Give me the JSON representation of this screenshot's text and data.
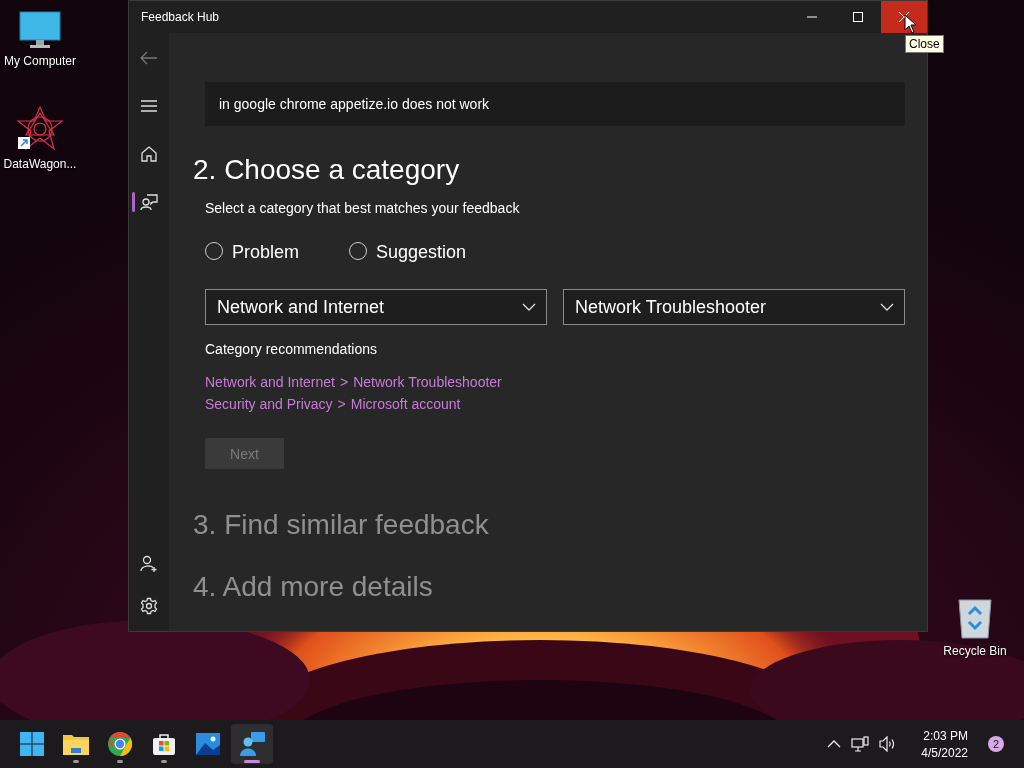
{
  "desktop_icons": [
    {
      "label": "My Computer",
      "kind": "computer"
    },
    {
      "label": "DataWagon...",
      "kind": "shortcut"
    },
    {
      "label": "Recycle Bin",
      "kind": "recycle"
    }
  ],
  "window": {
    "title": "Feedback Hub",
    "tooltip": "Close"
  },
  "nav_items": [
    {
      "kind": "home",
      "selected": false
    },
    {
      "kind": "feedback",
      "selected": true
    }
  ],
  "nav_bottom": [
    {
      "kind": "add-user"
    },
    {
      "kind": "settings"
    }
  ],
  "summary": {
    "value": "in google chrome appetize.io does not work"
  },
  "section": {
    "heading": "2. Choose a category",
    "instruction": "Select a category that best matches your feedback",
    "options": [
      {
        "label": "Problem",
        "selected": false
      },
      {
        "label": "Suggestion",
        "selected": false
      }
    ],
    "dropdowns": [
      {
        "value": "Network and Internet"
      },
      {
        "value": "Network Troubleshooter"
      }
    ],
    "recommendations_label": "Category recommendations",
    "recommendations": [
      {
        "category": "Network and Internet",
        "separator": ">",
        "subcategory": "Network Troubleshooter"
      },
      {
        "category": "Security and Privacy",
        "separator": ">",
        "subcategory": "Microsoft account"
      }
    ],
    "next": {
      "label": "Next",
      "disabled": true
    }
  },
  "later_steps": [
    "3. Find similar feedback",
    "4. Add more details"
  ],
  "taskbar": {
    "apps": [
      {
        "kind": "start",
        "running": false,
        "selected": false
      },
      {
        "kind": "folder",
        "running": true,
        "selected": false
      },
      {
        "kind": "browser",
        "running": true,
        "selected": false
      },
      {
        "kind": "store",
        "running": true,
        "selected": false
      },
      {
        "kind": "photos",
        "running": false,
        "selected": false
      },
      {
        "kind": "feedback",
        "running": true,
        "selected": true
      }
    ],
    "time": "2:03 PM",
    "date": "4/5/2022",
    "notification_count": "2"
  }
}
